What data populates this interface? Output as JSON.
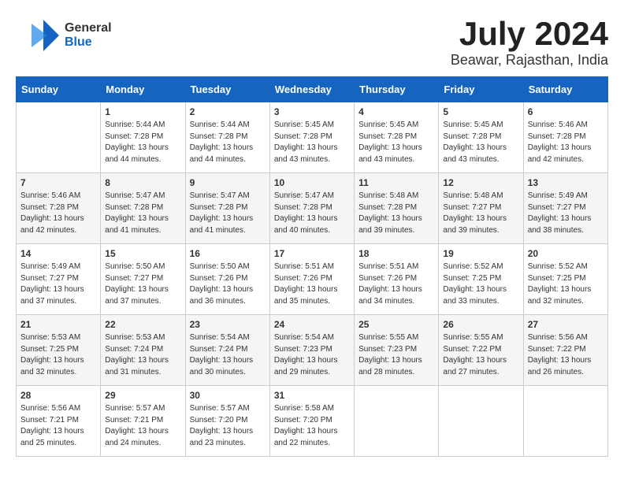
{
  "logo": {
    "general": "General",
    "blue": "Blue"
  },
  "title": {
    "month_year": "July 2024",
    "location": "Beawar, Rajasthan, India"
  },
  "days_header": [
    "Sunday",
    "Monday",
    "Tuesday",
    "Wednesday",
    "Thursday",
    "Friday",
    "Saturday"
  ],
  "weeks": [
    [
      {
        "day": "",
        "sunrise": "",
        "sunset": "",
        "daylight": ""
      },
      {
        "day": "1",
        "sunrise": "Sunrise: 5:44 AM",
        "sunset": "Sunset: 7:28 PM",
        "daylight": "Daylight: 13 hours and 44 minutes."
      },
      {
        "day": "2",
        "sunrise": "Sunrise: 5:44 AM",
        "sunset": "Sunset: 7:28 PM",
        "daylight": "Daylight: 13 hours and 44 minutes."
      },
      {
        "day": "3",
        "sunrise": "Sunrise: 5:45 AM",
        "sunset": "Sunset: 7:28 PM",
        "daylight": "Daylight: 13 hours and 43 minutes."
      },
      {
        "day": "4",
        "sunrise": "Sunrise: 5:45 AM",
        "sunset": "Sunset: 7:28 PM",
        "daylight": "Daylight: 13 hours and 43 minutes."
      },
      {
        "day": "5",
        "sunrise": "Sunrise: 5:45 AM",
        "sunset": "Sunset: 7:28 PM",
        "daylight": "Daylight: 13 hours and 43 minutes."
      },
      {
        "day": "6",
        "sunrise": "Sunrise: 5:46 AM",
        "sunset": "Sunset: 7:28 PM",
        "daylight": "Daylight: 13 hours and 42 minutes."
      }
    ],
    [
      {
        "day": "7",
        "sunrise": "Sunrise: 5:46 AM",
        "sunset": "Sunset: 7:28 PM",
        "daylight": "Daylight: 13 hours and 42 minutes."
      },
      {
        "day": "8",
        "sunrise": "Sunrise: 5:47 AM",
        "sunset": "Sunset: 7:28 PM",
        "daylight": "Daylight: 13 hours and 41 minutes."
      },
      {
        "day": "9",
        "sunrise": "Sunrise: 5:47 AM",
        "sunset": "Sunset: 7:28 PM",
        "daylight": "Daylight: 13 hours and 41 minutes."
      },
      {
        "day": "10",
        "sunrise": "Sunrise: 5:47 AM",
        "sunset": "Sunset: 7:28 PM",
        "daylight": "Daylight: 13 hours and 40 minutes."
      },
      {
        "day": "11",
        "sunrise": "Sunrise: 5:48 AM",
        "sunset": "Sunset: 7:28 PM",
        "daylight": "Daylight: 13 hours and 39 minutes."
      },
      {
        "day": "12",
        "sunrise": "Sunrise: 5:48 AM",
        "sunset": "Sunset: 7:27 PM",
        "daylight": "Daylight: 13 hours and 39 minutes."
      },
      {
        "day": "13",
        "sunrise": "Sunrise: 5:49 AM",
        "sunset": "Sunset: 7:27 PM",
        "daylight": "Daylight: 13 hours and 38 minutes."
      }
    ],
    [
      {
        "day": "14",
        "sunrise": "Sunrise: 5:49 AM",
        "sunset": "Sunset: 7:27 PM",
        "daylight": "Daylight: 13 hours and 37 minutes."
      },
      {
        "day": "15",
        "sunrise": "Sunrise: 5:50 AM",
        "sunset": "Sunset: 7:27 PM",
        "daylight": "Daylight: 13 hours and 37 minutes."
      },
      {
        "day": "16",
        "sunrise": "Sunrise: 5:50 AM",
        "sunset": "Sunset: 7:26 PM",
        "daylight": "Daylight: 13 hours and 36 minutes."
      },
      {
        "day": "17",
        "sunrise": "Sunrise: 5:51 AM",
        "sunset": "Sunset: 7:26 PM",
        "daylight": "Daylight: 13 hours and 35 minutes."
      },
      {
        "day": "18",
        "sunrise": "Sunrise: 5:51 AM",
        "sunset": "Sunset: 7:26 PM",
        "daylight": "Daylight: 13 hours and 34 minutes."
      },
      {
        "day": "19",
        "sunrise": "Sunrise: 5:52 AM",
        "sunset": "Sunset: 7:25 PM",
        "daylight": "Daylight: 13 hours and 33 minutes."
      },
      {
        "day": "20",
        "sunrise": "Sunrise: 5:52 AM",
        "sunset": "Sunset: 7:25 PM",
        "daylight": "Daylight: 13 hours and 32 minutes."
      }
    ],
    [
      {
        "day": "21",
        "sunrise": "Sunrise: 5:53 AM",
        "sunset": "Sunset: 7:25 PM",
        "daylight": "Daylight: 13 hours and 32 minutes."
      },
      {
        "day": "22",
        "sunrise": "Sunrise: 5:53 AM",
        "sunset": "Sunset: 7:24 PM",
        "daylight": "Daylight: 13 hours and 31 minutes."
      },
      {
        "day": "23",
        "sunrise": "Sunrise: 5:54 AM",
        "sunset": "Sunset: 7:24 PM",
        "daylight": "Daylight: 13 hours and 30 minutes."
      },
      {
        "day": "24",
        "sunrise": "Sunrise: 5:54 AM",
        "sunset": "Sunset: 7:23 PM",
        "daylight": "Daylight: 13 hours and 29 minutes."
      },
      {
        "day": "25",
        "sunrise": "Sunrise: 5:55 AM",
        "sunset": "Sunset: 7:23 PM",
        "daylight": "Daylight: 13 hours and 28 minutes."
      },
      {
        "day": "26",
        "sunrise": "Sunrise: 5:55 AM",
        "sunset": "Sunset: 7:22 PM",
        "daylight": "Daylight: 13 hours and 27 minutes."
      },
      {
        "day": "27",
        "sunrise": "Sunrise: 5:56 AM",
        "sunset": "Sunset: 7:22 PM",
        "daylight": "Daylight: 13 hours and 26 minutes."
      }
    ],
    [
      {
        "day": "28",
        "sunrise": "Sunrise: 5:56 AM",
        "sunset": "Sunset: 7:21 PM",
        "daylight": "Daylight: 13 hours and 25 minutes."
      },
      {
        "day": "29",
        "sunrise": "Sunrise: 5:57 AM",
        "sunset": "Sunset: 7:21 PM",
        "daylight": "Daylight: 13 hours and 24 minutes."
      },
      {
        "day": "30",
        "sunrise": "Sunrise: 5:57 AM",
        "sunset": "Sunset: 7:20 PM",
        "daylight": "Daylight: 13 hours and 23 minutes."
      },
      {
        "day": "31",
        "sunrise": "Sunrise: 5:58 AM",
        "sunset": "Sunset: 7:20 PM",
        "daylight": "Daylight: 13 hours and 22 minutes."
      },
      {
        "day": "",
        "sunrise": "",
        "sunset": "",
        "daylight": ""
      },
      {
        "day": "",
        "sunrise": "",
        "sunset": "",
        "daylight": ""
      },
      {
        "day": "",
        "sunrise": "",
        "sunset": "",
        "daylight": ""
      }
    ]
  ]
}
